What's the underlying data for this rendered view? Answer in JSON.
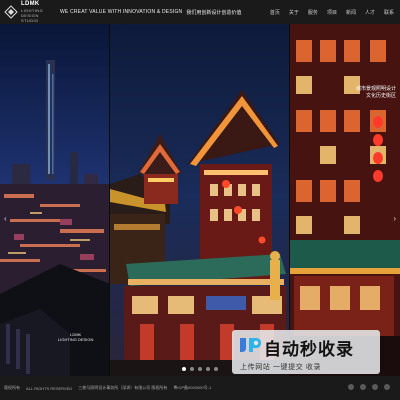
{
  "header": {
    "logo_line1": "LDMK",
    "logo_line2": "LIGHTING",
    "logo_line3": "DESIGN",
    "logo_line4": "STUDIO",
    "slogan_en": "WE CREAT VALUE WITH INNOVATION & DESIGN",
    "slogan_cn": "我们用创新设计创造价值",
    "nav": [
      "首页",
      "关于",
      "服务",
      "项目",
      "新闻",
      "人才",
      "联系"
    ]
  },
  "gallery": {
    "overlay_title_line1": "城市景观照明设计",
    "overlay_title_line2": "文化历史街区",
    "badge_line1": "LDMK",
    "badge_line2": "LIGHTING DESIGN",
    "prev_arrow": "‹",
    "next_arrow": "›",
    "dots": [
      true,
      false,
      false,
      false,
      false
    ]
  },
  "watermark": {
    "title": "自动秒收录",
    "subtitle": "上传网站 一键提交 收录"
  },
  "footer": {
    "copyright": "版权所有",
    "rights": "ALL RIGHTS RESERVED",
    "company": "三棱马照明设计事务所（深圳）有限公司 版权所有",
    "icp": "粤ICP备0000000号-1"
  },
  "colors": {
    "header_bg": "#1a1a1a",
    "accent_gold": "#e8a23a",
    "accent_red": "#c8332a",
    "night_blue": "#1a2a5a"
  }
}
